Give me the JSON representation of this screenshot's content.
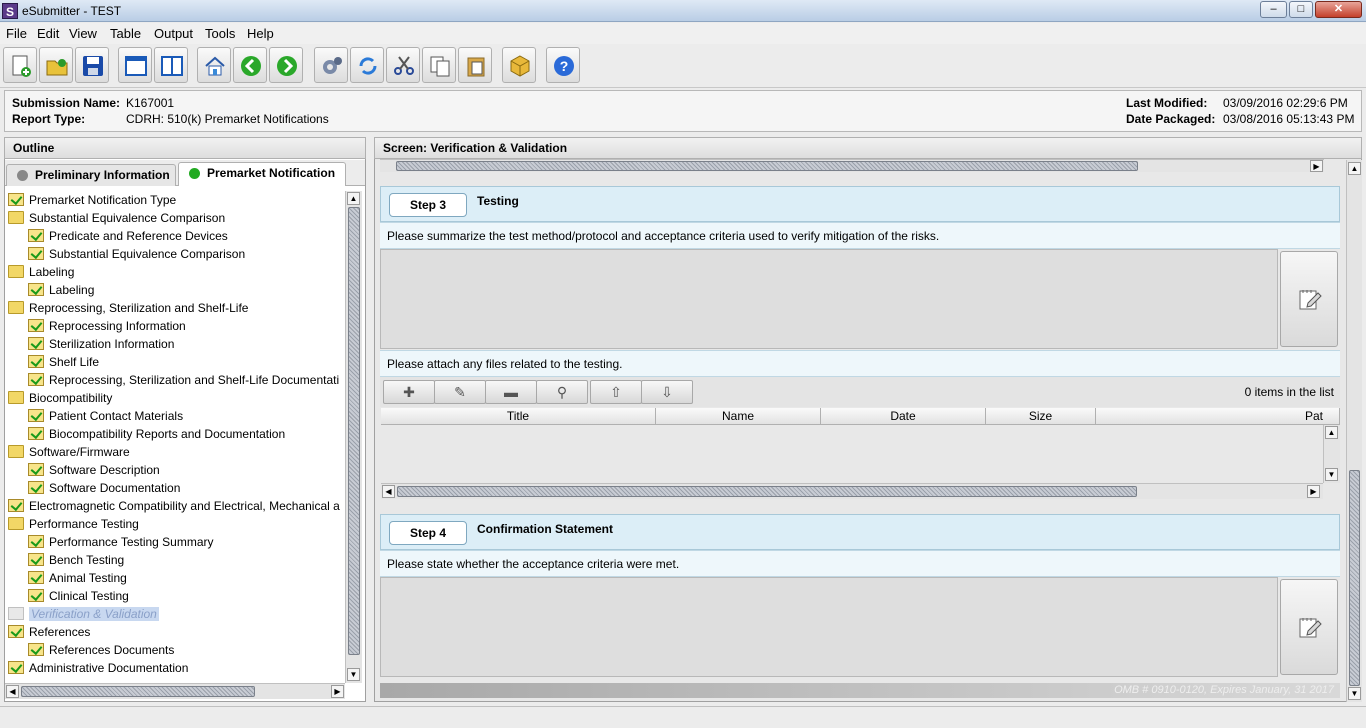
{
  "window": {
    "title": "eSubmitter - TEST",
    "app_icon_letter": "S",
    "controls": {
      "minimize": "–",
      "maximize": "□",
      "close": "✕"
    }
  },
  "menu": [
    "File",
    "Edit",
    "View",
    "Table",
    "Output",
    "Tools",
    "Help"
  ],
  "toolbar": {
    "buttons": [
      "new-document-icon",
      "open-folder-icon",
      "save-icon",
      "window-icon",
      "split-view-icon",
      "home-icon",
      "back-arrow-icon",
      "forward-arrow-icon",
      "gear-icon",
      "refresh-icon",
      "cut-icon",
      "copy-icon",
      "paste-icon",
      "package-icon",
      "help-icon"
    ]
  },
  "info": {
    "submission_name_label": "Submission Name:",
    "submission_name": "K167001",
    "report_type_label": "Report Type:",
    "report_type": "CDRH: 510(k) Premarket Notifications",
    "last_modified_label": "Last Modified:",
    "last_modified": "03/09/2016 02:29:6 PM",
    "date_packaged_label": "Date Packaged:",
    "date_packaged": "03/08/2016 05:13:43 PM"
  },
  "outline": {
    "header": "Outline",
    "tabs": [
      {
        "label": "Preliminary Information",
        "status_color": "#888888"
      },
      {
        "label": "Premarket Notification",
        "status_color": "#22aa22"
      }
    ],
    "items": [
      {
        "label": "Premarket Notification Type",
        "level": 0,
        "icon": "check"
      },
      {
        "label": "Substantial Equivalence Comparison",
        "level": 0,
        "icon": "folder"
      },
      {
        "label": "Predicate and Reference Devices",
        "level": 1,
        "icon": "check"
      },
      {
        "label": "Substantial Equivalence Comparison",
        "level": 1,
        "icon": "check"
      },
      {
        "label": "Labeling",
        "level": 0,
        "icon": "folder"
      },
      {
        "label": "Labeling",
        "level": 1,
        "icon": "check"
      },
      {
        "label": "Reprocessing, Sterilization and Shelf-Life",
        "level": 0,
        "icon": "folder"
      },
      {
        "label": "Reprocessing Information",
        "level": 1,
        "icon": "check"
      },
      {
        "label": "Sterilization Information",
        "level": 1,
        "icon": "check"
      },
      {
        "label": "Shelf Life",
        "level": 1,
        "icon": "check"
      },
      {
        "label": "Reprocessing, Sterilization and Shelf-Life Documentati",
        "level": 1,
        "icon": "check"
      },
      {
        "label": "Biocompatibility",
        "level": 0,
        "icon": "folder"
      },
      {
        "label": "Patient Contact Materials",
        "level": 1,
        "icon": "check"
      },
      {
        "label": "Biocompatibility Reports and Documentation",
        "level": 1,
        "icon": "check"
      },
      {
        "label": "Software/Firmware",
        "level": 0,
        "icon": "folder"
      },
      {
        "label": "Software Description",
        "level": 1,
        "icon": "check"
      },
      {
        "label": "Software Documentation",
        "level": 1,
        "icon": "check"
      },
      {
        "label": "Electromagnetic Compatibility and Electrical, Mechanical a",
        "level": 0,
        "icon": "check"
      },
      {
        "label": "Performance Testing",
        "level": 0,
        "icon": "folder"
      },
      {
        "label": "Performance Testing Summary",
        "level": 1,
        "icon": "check"
      },
      {
        "label": "Bench Testing",
        "level": 1,
        "icon": "check"
      },
      {
        "label": "Animal Testing",
        "level": 1,
        "icon": "check"
      },
      {
        "label": "Clinical Testing",
        "level": 1,
        "icon": "check"
      },
      {
        "label": "Verification & Validation",
        "level": 0,
        "icon": "folder-empty",
        "selected": true
      },
      {
        "label": "References",
        "level": 0,
        "icon": "check"
      },
      {
        "label": "References Documents",
        "level": 1,
        "icon": "check"
      },
      {
        "label": "Administrative Documentation",
        "level": 0,
        "icon": "check"
      }
    ]
  },
  "screen": {
    "header": "Screen: Verification & Validation",
    "step3": {
      "badge": "Step 3",
      "title": "Testing",
      "prompt": "Please summarize the test method/protocol and acceptance criteria used to verify mitigation of the risks.",
      "attach_prompt": "Please attach any files related to the testing.",
      "items_count": "0 items in the list",
      "columns": [
        "Title",
        "Name",
        "Date",
        "Size",
        "Pat"
      ]
    },
    "step4": {
      "badge": "Step 4",
      "title": "Confirmation Statement",
      "prompt": "Please state whether the acceptance criteria were met."
    },
    "footer": "OMB # 0910-0120, Expires January, 31 2017"
  }
}
